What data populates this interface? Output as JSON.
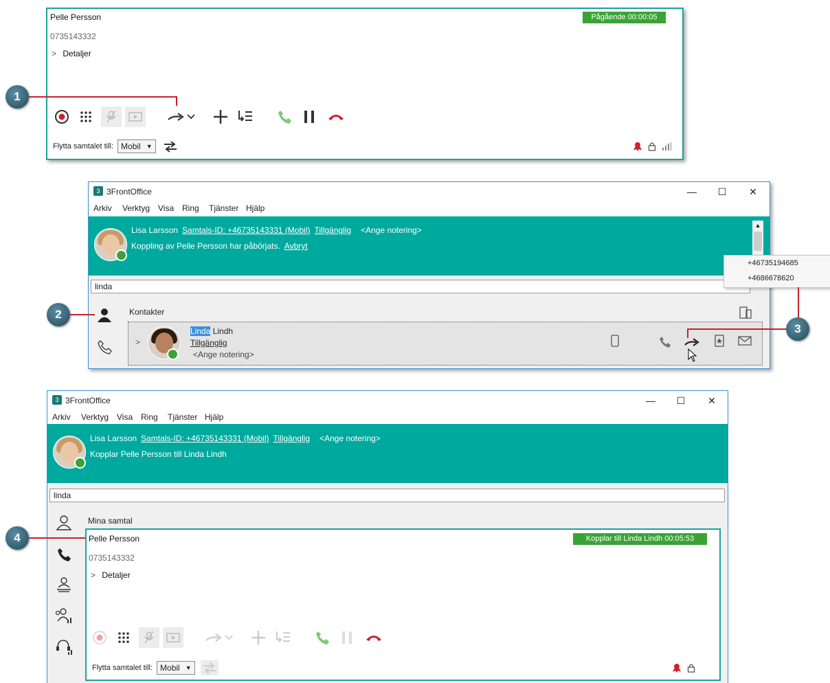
{
  "callouts": {
    "one": "1",
    "two": "2",
    "three": "3",
    "four": "4"
  },
  "call_panel_top": {
    "caller_name": "Pelle Persson",
    "caller_number": "0735143332",
    "details_label": "Detaljer",
    "status": "Pågående 00:00:05",
    "move_label": "Flytta samtalet till:",
    "move_select": "Mobil"
  },
  "window_mid": {
    "title": "3FrontOffice",
    "menu": [
      "Arkiv",
      "Verktyg",
      "Visa",
      "Ring",
      "Tjänster",
      "Hjälp"
    ],
    "user_name": "Lisa Larsson",
    "call_id": "Samtals-ID: +46735143331 (Mobil)",
    "availability": "Tillgänglig",
    "note": "<Ange notering>",
    "status_text": "Koppling av Pelle Persson har påbörjats.",
    "cancel_link": "Avbryt",
    "search_value": "linda",
    "section_contacts": "Kontakter",
    "contact": {
      "first_name_match": "Linda",
      "last_name": "Lindh",
      "availability": "Tillgänglig",
      "note": "<Ange notering>"
    },
    "dropdown_numbers": [
      "+46735194685",
      "+4686678620"
    ]
  },
  "window_bottom": {
    "title": "3FrontOffice",
    "menu": [
      "Arkiv",
      "Verktyg",
      "Visa",
      "Ring",
      "Tjänster",
      "Hjälp"
    ],
    "user_name": "Lisa Larsson",
    "call_id": "Samtals-ID: +46735143331 (Mobil)",
    "availability": "Tillgänglig",
    "note": "<Ange notering>",
    "status_text": "Kopplar Pelle Persson till Linda Lindh",
    "search_value": "linda",
    "section_calls": "Mina samtal",
    "call": {
      "caller_name": "Pelle Persson",
      "caller_number": "0735143332",
      "details_label": "Detaljer",
      "status": "Kopplar till Linda Lindh 00:05:53",
      "move_label": "Flytta samtalet till:",
      "move_select": "Mobil"
    }
  },
  "colors": {
    "teal": "#00a99d",
    "green": "#3aa335",
    "red": "#d02030",
    "callout": "#3a6c7e"
  }
}
